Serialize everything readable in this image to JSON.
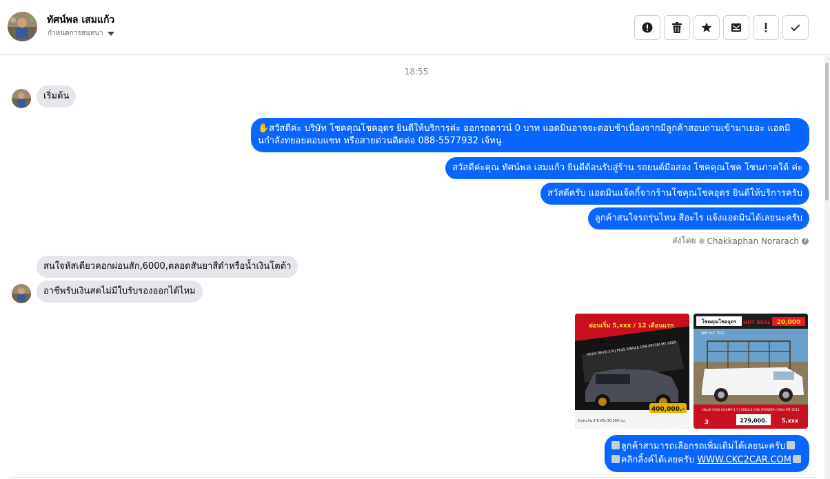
{
  "header": {
    "name": "ทัศน์พล เสมแก้ว",
    "subtitle": "กำหนดการสนทนา",
    "actions": [
      {
        "label": "",
        "icon": "alert-circle-icon"
      },
      {
        "label": "",
        "icon": "trash-icon"
      },
      {
        "label": "",
        "icon": "star-icon"
      },
      {
        "label": "",
        "icon": "inbox-move-icon"
      },
      {
        "label": "",
        "icon": "exclamation-icon"
      },
      {
        "label": "",
        "icon": "checkmark-icon"
      }
    ]
  },
  "chat": {
    "timestamp": "18:55",
    "messages": [
      {
        "side": "in",
        "text": "เริ่มต้น"
      },
      {
        "side": "out",
        "text": "✋สวัสดีค่ะ บริษัท โชคคุณโชคอุดร ยินดีให้บริการค่ะ ออกรถดาวน์ 0 บาท แอดมินอาจจะตอบช้าเนื่องจากมีลูกค้าสอบถามเข้ามาเยอะ แอดมินกำลังทยอยตอบแชท หรือสายด่วนติดต่อ 088-5577932 เจ้หนู"
      },
      {
        "side": "out",
        "text": "สวัสดีค่ะคุณ ทัศน์พล เสมแก้ว ยินดีต้อนรับสู่ร้าน รถยนต์มือสอง โชคคุณโชค โซนภาคใต้ ค่ะ"
      },
      {
        "side": "out",
        "text": "สวัสดีครับ แอดมินแจ้คกี้จากร้านโชคุณโชคอุดร ยินดีให้บริการครับ"
      },
      {
        "side": "out",
        "text": "ลูกค้าสนใจรถรุ่นไหน สีอะไร แจ้งแอดมินได้เลยนะครับ"
      },
      {
        "side": "in",
        "text": "สนใจหัสเดียวคอกผ่อนสัก,6000,ตลอดสันยาสีดำหรือน้ำเงินโตต้า"
      },
      {
        "side": "in",
        "text": "อาชีพรับเงินสดไม่มีใบรับรองออกได้ไหม"
      },
      {
        "side": "out",
        "line1": "ลูกค้าสามารถเลือกรถเพิ่มเติมได้เลยนะครับ",
        "line2_prefix": "คลิกลิ้งค์ได้เลยครับ ",
        "link": "WWW.CKC2CAR.COM"
      }
    ],
    "sent_by_label": "ส่งโดย",
    "sent_by_name": "Chakkaphan Norarach",
    "photos": [
      {
        "promo": "ผ่อนเริ่ม 5,xxx / 12 เดือนแรก",
        "model": "HILUX REVO 2.8 J PLUS SINGLE CAB (MY18) MT 2020",
        "price": "400,000.-",
        "fine_print": "รับประกัน 3 ปี หรือ 30,000 กม."
      },
      {
        "brand": "โชคคุณโชคอุดร",
        "badge": "HOT DEAL",
        "promo_price": "20,000",
        "phone": "088 557 7932",
        "model": "HILUX VIGO CHAMP 2.7 J SINGLE CAB (POWER) (CNG) MT 2015",
        "price": "279,000.",
        "installment": "5,xxx",
        "years": "3"
      }
    ]
  },
  "colors": {
    "brand_blue": "#0866ff",
    "incoming_bubble": "#e4e6eb",
    "border": "#dadde1"
  }
}
